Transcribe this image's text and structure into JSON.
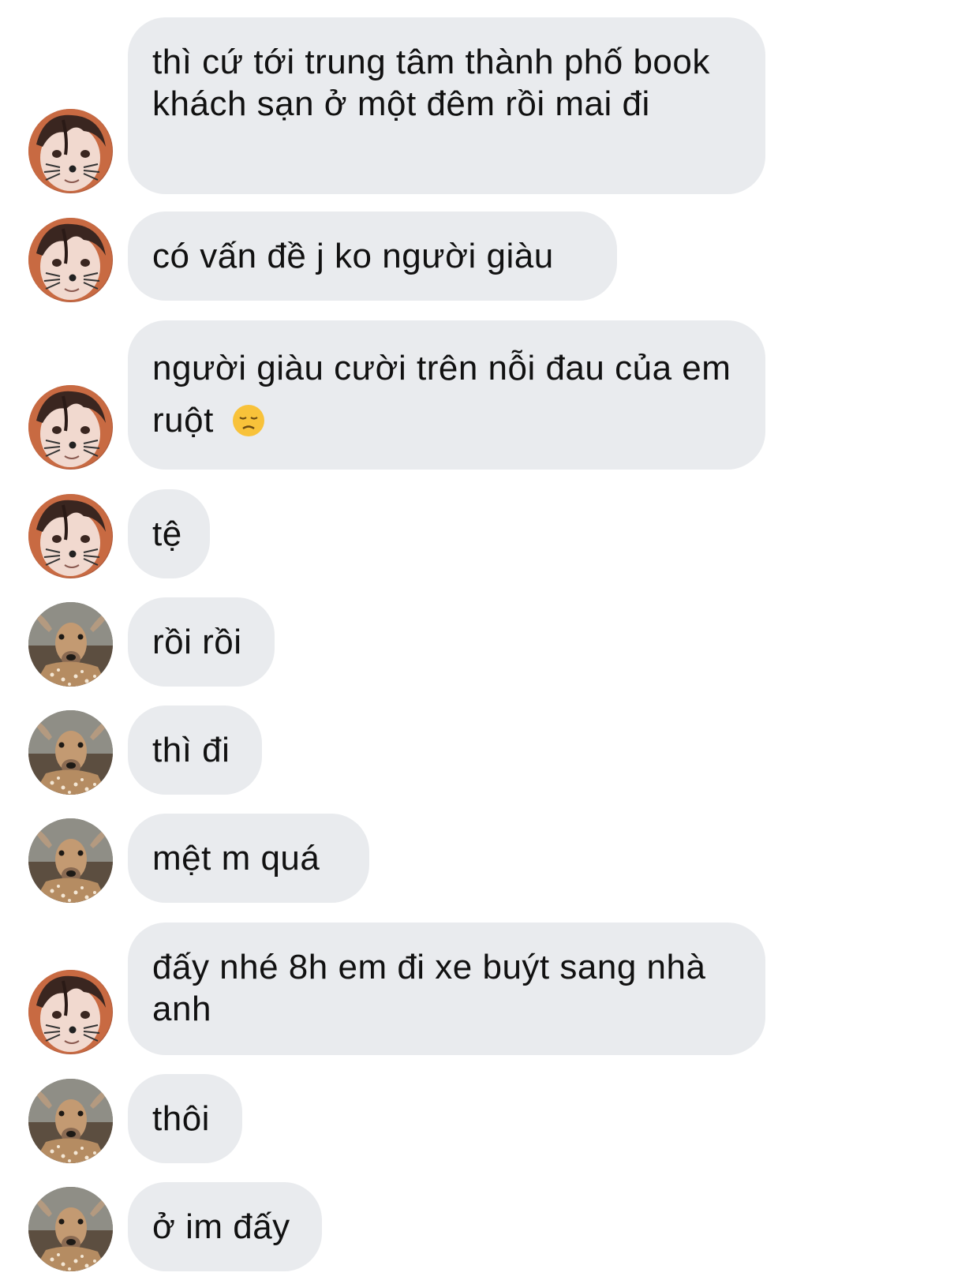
{
  "conversation": {
    "messages": [
      {
        "sender": "boy",
        "text": "thì cứ tới trung tâm thành phố book khách sạn ở một đêm rồi mai đi"
      },
      {
        "sender": "boy",
        "text": "có vấn đề j ko người giàu"
      },
      {
        "sender": "boy",
        "text": "người giàu cười trên nỗi đau của em ruột",
        "emoji": "disappointed-face"
      },
      {
        "sender": "boy",
        "text": "tệ"
      },
      {
        "sender": "deer",
        "text": "rồi rồi"
      },
      {
        "sender": "deer",
        "text": "thì đi"
      },
      {
        "sender": "deer",
        "text": "mệt m quá"
      },
      {
        "sender": "boy",
        "text": "đấy nhé 8h em đi xe buýt sang nhà anh"
      },
      {
        "sender": "deer",
        "text": "thôi"
      },
      {
        "sender": "deer",
        "text": "ở im đấy"
      }
    ]
  },
  "colors": {
    "bubble_bg": "#e9ebee",
    "text": "#111111",
    "background": "#ffffff"
  },
  "icons": {
    "boy_avatar": "boy-cat-filter-avatar",
    "deer_avatar": "deer-avatar",
    "emoji": "disappointed-face-emoji"
  }
}
